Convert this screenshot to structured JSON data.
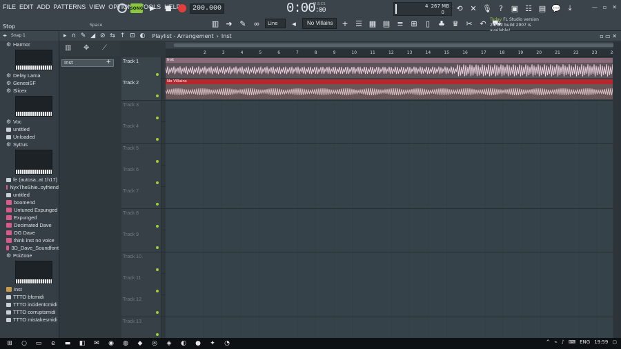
{
  "menu": [
    "FILE",
    "EDIT",
    "ADD",
    "PATTERNS",
    "VIEW",
    "OPTIONS",
    "TOOLS",
    "HELP"
  ],
  "status": {
    "stop_label": "Stop",
    "space_label": "Space"
  },
  "transport": {
    "mode": "SONG",
    "tempo": "200.000",
    "time_main": "0:00",
    "time_sub": ":00",
    "time_unit": "M:S:CS"
  },
  "cpu": {
    "value": "4",
    "ram": "267 MB",
    "poly": "0"
  },
  "toolbar": {
    "snap_mode": "Line",
    "pattern": "No Villains"
  },
  "news": {
    "prefix": "Today",
    "text": "FL Studio version 20.9.2 build 2907 is available!"
  },
  "browser": {
    "header": [
      "Snap 1"
    ],
    "items": [
      {
        "label": "Harmor",
        "type": "plugin"
      },
      {
        "label": "Delay Lama",
        "type": "plugin"
      },
      {
        "label": "GenesiSF",
        "type": "plugin"
      },
      {
        "label": "Slicex",
        "type": "plugin"
      },
      {
        "label": "Voc",
        "type": "plugin"
      },
      {
        "label": "untitled",
        "type": "file"
      },
      {
        "label": "Unloaded",
        "type": "file"
      },
      {
        "label": "Sytrus",
        "type": "plugin"
      },
      {
        "label": "fe (autosa..at 1h17)",
        "type": "file"
      },
      {
        "label": "NyxTheShie..oyfriend",
        "type": "pattern"
      },
      {
        "label": "untitled",
        "type": "file"
      },
      {
        "label": "boomend",
        "type": "pattern"
      },
      {
        "label": "Untuned Expunged",
        "type": "pattern"
      },
      {
        "label": "Expunged",
        "type": "pattern"
      },
      {
        "label": "Decimated Dave",
        "type": "pattern"
      },
      {
        "label": "OG Dave",
        "type": "pattern"
      },
      {
        "label": "think inst no voice",
        "type": "pattern"
      },
      {
        "label": "3D_Dave_Soundfont",
        "type": "pattern"
      },
      {
        "label": "PoiZone",
        "type": "plugin"
      },
      {
        "label": "Inst",
        "type": "audio"
      },
      {
        "label": "TTTO bfcmidi",
        "type": "file"
      },
      {
        "label": "TTTO incidentcmidi",
        "type": "file"
      },
      {
        "label": "TTTO corruptsmidi",
        "type": "file"
      },
      {
        "label": "TTTO mistakesmidi",
        "type": "file"
      }
    ]
  },
  "playlist": {
    "title": "Playlist - Arrangement",
    "clip": "Inst",
    "selected_clip_label": "Inst",
    "ruler": [
      "2",
      "3",
      "4",
      "5",
      "6",
      "7",
      "8",
      "9",
      "10",
      "11",
      "12",
      "13",
      "14",
      "15",
      "16",
      "17",
      "18",
      "19",
      "20",
      "21",
      "22",
      "23",
      "24"
    ],
    "tracks": [
      {
        "name": "Track 1",
        "clip": "Inst",
        "clip_color": "#8a6a78"
      },
      {
        "name": "Track 2",
        "clip": "No Villains",
        "clip_color": "#b8262c"
      },
      {
        "name": "Track 3"
      },
      {
        "name": "Track 4"
      },
      {
        "name": "Track 5"
      },
      {
        "name": "Track 6"
      },
      {
        "name": "Track 7"
      },
      {
        "name": "Track 8"
      },
      {
        "name": "Track 9"
      },
      {
        "name": "Track 10"
      },
      {
        "name": "Track 11"
      },
      {
        "name": "Track 12"
      },
      {
        "name": "Track 13"
      }
    ]
  },
  "taskbar": {
    "lang": "ENG",
    "clock": "19:59"
  }
}
